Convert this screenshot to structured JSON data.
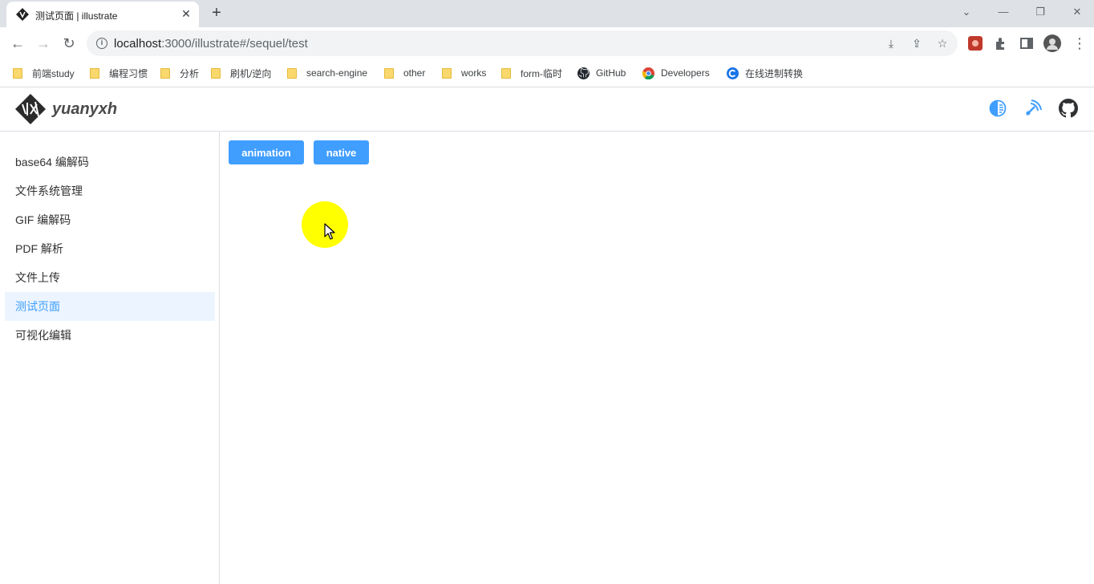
{
  "browser": {
    "tab_title": "测试页面 | illustrate",
    "tab_close": "✕",
    "new_tab": "+",
    "url_host": "localhost",
    "url_path": ":3000/illustrate#/sequel/test",
    "bookmarks": [
      {
        "label": "前端study",
        "icon": "folder"
      },
      {
        "label": "编程习惯",
        "icon": "folder"
      },
      {
        "label": "分析",
        "icon": "folder"
      },
      {
        "label": "刷机/逆向",
        "icon": "folder"
      },
      {
        "label": "search-engine",
        "icon": "folder"
      },
      {
        "label": "other",
        "icon": "folder"
      },
      {
        "label": "works",
        "icon": "folder"
      },
      {
        "label": "form-临时",
        "icon": "folder"
      },
      {
        "label": "GitHub",
        "icon": "github-icon"
      },
      {
        "label": "Developers",
        "icon": "chrome-icon"
      },
      {
        "label": "在线进制转换",
        "icon": "globe-icon"
      }
    ]
  },
  "app": {
    "brand": "yuanyxh",
    "header_icons": [
      "theme-toggle-icon",
      "rss-feed-icon",
      "github-icon"
    ],
    "accent_color": "#409eff",
    "sidebar": {
      "items": [
        {
          "label": "base64 编解码",
          "active": false
        },
        {
          "label": "文件系统管理",
          "active": false
        },
        {
          "label": "GIF 编解码",
          "active": false
        },
        {
          "label": "PDF 解析",
          "active": false
        },
        {
          "label": "文件上传",
          "active": false
        },
        {
          "label": "测试页面",
          "active": true
        },
        {
          "label": "可视化编辑",
          "active": false
        }
      ]
    },
    "main": {
      "buttons": [
        {
          "label": "animation"
        },
        {
          "label": "native"
        }
      ]
    }
  }
}
